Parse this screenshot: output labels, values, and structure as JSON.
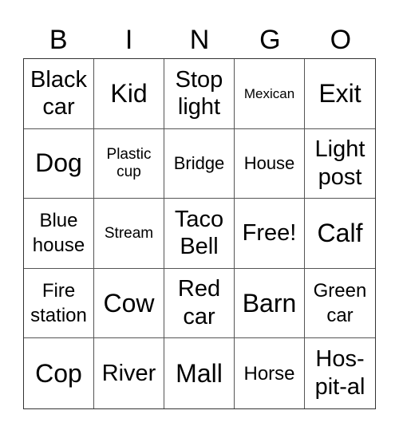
{
  "header": {
    "letters": [
      "B",
      "I",
      "N",
      "G",
      "O"
    ]
  },
  "cells": [
    {
      "text": "Black car",
      "size": "l"
    },
    {
      "text": "Kid",
      "size": "xl"
    },
    {
      "text": "Stop light",
      "size": "l"
    },
    {
      "text": "Mexican",
      "size": "xs"
    },
    {
      "text": "Exit",
      "size": "xl"
    },
    {
      "text": "Dog",
      "size": "xl"
    },
    {
      "text": "Plastic cup",
      "size": "s"
    },
    {
      "text": "Bridge",
      "size": "sm"
    },
    {
      "text": "House",
      "size": "sm"
    },
    {
      "text": "Light post",
      "size": "l"
    },
    {
      "text": "Blue house",
      "size": "m"
    },
    {
      "text": "Stream",
      "size": "s"
    },
    {
      "text": "Taco Bell",
      "size": "l"
    },
    {
      "text": "Free!",
      "size": "l"
    },
    {
      "text": "Calf",
      "size": "xl"
    },
    {
      "text": "Fire station",
      "size": "m"
    },
    {
      "text": "Cow",
      "size": "xl"
    },
    {
      "text": "Red car",
      "size": "l"
    },
    {
      "text": "Barn",
      "size": "xl"
    },
    {
      "text": "Green car",
      "size": "m"
    },
    {
      "text": "Cop",
      "size": "xl"
    },
    {
      "text": "River",
      "size": "l"
    },
    {
      "text": "Mall",
      "size": "xl"
    },
    {
      "text": "Horse",
      "size": "m"
    },
    {
      "text": "Hos-pit-al",
      "size": "l"
    }
  ]
}
